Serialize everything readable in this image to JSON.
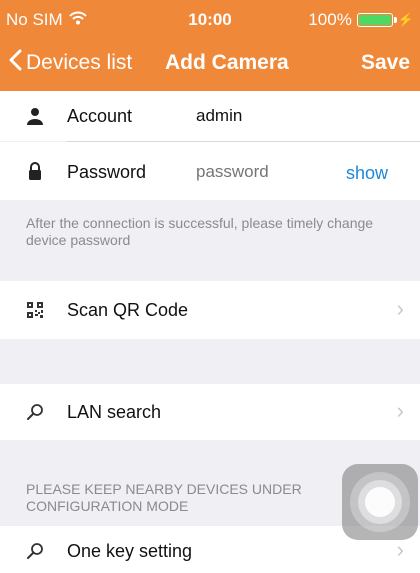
{
  "status_bar": {
    "carrier": "No SIM",
    "wifi_icon": "wifi-icon",
    "time": "10:00",
    "battery": "100%",
    "battery_level": 1.0,
    "charging_icon": "bolt-icon"
  },
  "nav": {
    "back_label": "Devices list",
    "title": "Add Camera",
    "save_label": "Save",
    "accent": "#f0883a"
  },
  "account": {
    "label": "Account",
    "value": "admin",
    "icon": "person-icon"
  },
  "password": {
    "label": "Password",
    "placeholder": "password",
    "show_label": "show",
    "show_color": "#1e88d8",
    "icon": "lock-icon"
  },
  "password_note": "After the connection is successful, please timely change device password",
  "scan_qr": {
    "label": "Scan QR Code",
    "icon": "qr-code-icon"
  },
  "lan_search": {
    "label": "LAN search",
    "icon": "search-icon"
  },
  "config_note": "PLEASE KEEP NEARBY DEVICES UNDER CONFIGURATION MODE",
  "one_key": {
    "label": "One key setting",
    "icon": "search-icon"
  },
  "chevron": "›"
}
